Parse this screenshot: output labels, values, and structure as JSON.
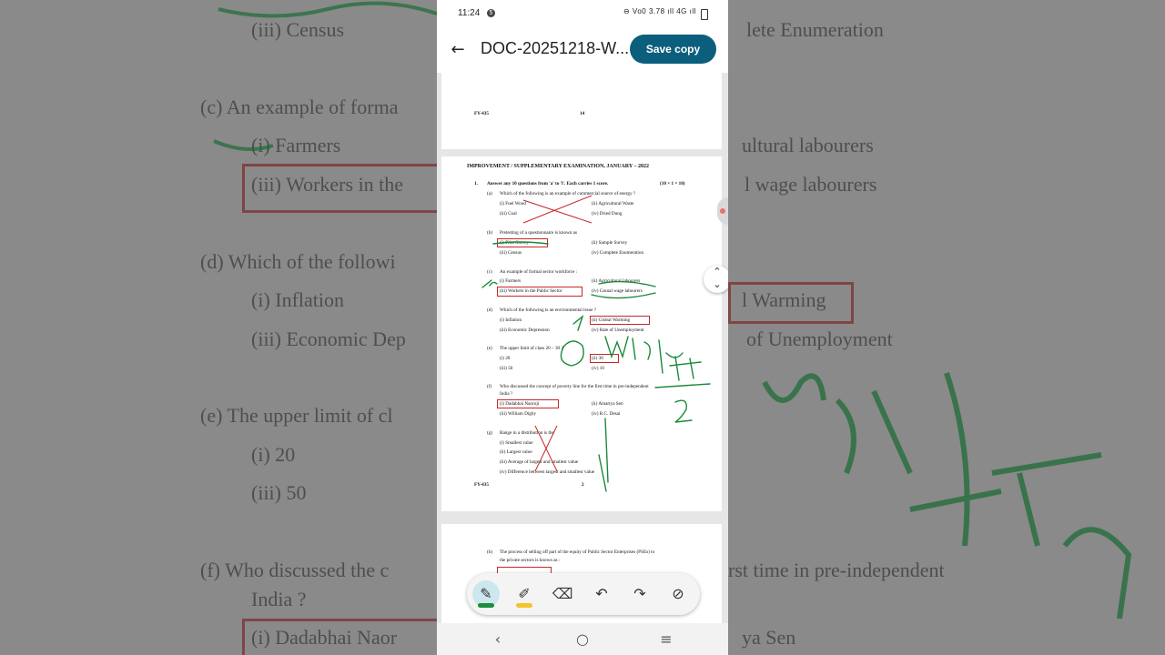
{
  "background": {
    "lines": [
      "(iii)   Census",
      "lete Enumeration",
      "(c)   An example of forma",
      "(i)   Farmers",
      "ultural labourers",
      "(iii)  Workers in the",
      "l wage labourers",
      "(d)   Which of the followi",
      "(i)   Inflation",
      "l Warming",
      "(iii)  Economic Dep",
      "of Unemployment",
      "(e)   The upper limit of cl",
      "(i)    20",
      "(iii)   50",
      "(f)    Who discussed the c",
      "rst time in pre-independent",
      "India ?",
      "(i)   Dadabhai Naor",
      "ya Sen"
    ]
  },
  "status_bar": {
    "time": "11:24",
    "notif": "5",
    "right": "⊖ Vo0 3.78  ıll 4G ıll"
  },
  "app_bar": {
    "title": "DOC-20251218-W...",
    "save_label": "Save copy"
  },
  "page1": {
    "code": "FY-435",
    "num": "14"
  },
  "page2": {
    "heading": "IMPROVEMENT / SUPPLEMENTARY EXAMINATION, JANUARY – 2022",
    "q1": "1.",
    "instruction": "Answer any 10 questions from 'a' to 'l'. Each carries 1 score.",
    "marks": "(10 × 1 = 10)",
    "questions": [
      {
        "label": "(a)",
        "text": "Which of the following is an example of commercial source of energy ?",
        "opts": [
          "(i)     Fuel Wood",
          "(ii)     Agricultural Waste",
          "(iii)   Coal",
          "(iv)    Dried Dung"
        ]
      },
      {
        "label": "(b)",
        "text": "Pretesting of a questionnaire is known as",
        "opts": [
          "(i)     Pilot Survey",
          "(ii)     Sample Survey",
          "(iii)   Census",
          "(iv)    Complete Enumeration"
        ]
      },
      {
        "label": "(c)",
        "text": "An example of formal sector workforce :",
        "opts": [
          "(i)     Farmers",
          "(ii)     Agricultural labourers",
          "(iii)   Workers in the Public Sector",
          "(iv)    Casual wage labourers"
        ]
      },
      {
        "label": "(d)",
        "text": "Which of the following is an environmental issue ?",
        "opts": [
          "(i)     Inflation",
          "(ii)     Global Warming",
          "(iii)   Economic Depression",
          "(iv)    Rate of Unemployment"
        ]
      },
      {
        "label": "(e)",
        "text": "The upper limit of class 20 – 30 ?",
        "opts": [
          "(i)     20",
          "(ii)     30",
          "(iii)   50",
          "(iv)    10"
        ]
      },
      {
        "label": "(f)",
        "text": "Who discussed the concept of poverty line for the first time in pre-independent",
        "text2": "India ?",
        "opts": [
          "(i)     Dadabhai Naoroji",
          "(ii)     Amartya Sen",
          "(iii)   William Digby",
          "(iv)    R.C. Desai"
        ]
      },
      {
        "label": "(g)",
        "text": "Range in a distribution is the",
        "opts": [
          "(i)     Smallest value",
          "(ii)     Largest value",
          "(iii)    Average of largest and smallest value",
          "(iv)    Difference between largest and smallest value"
        ]
      }
    ],
    "footer_code": "FY-435",
    "footer_num": "2"
  },
  "page3": {
    "label": "(h)",
    "text": "The process of selling off part of the equity of Public Sector Enterprises (PSEs) to",
    "text2": "the private sectors is known as :"
  },
  "toolbar": {
    "pen": "pen-icon",
    "highlighter": "highlighter-icon",
    "eraser": "eraser-icon",
    "undo": "undo-icon",
    "redo": "redo-icon",
    "hide": "eye-off-icon",
    "pen_color": "#1a8f3c",
    "highlight_color": "#f4c430"
  },
  "colors": {
    "accent": "#0b5f7d",
    "ink": "#1a8a3a",
    "mark": "#c62828"
  }
}
